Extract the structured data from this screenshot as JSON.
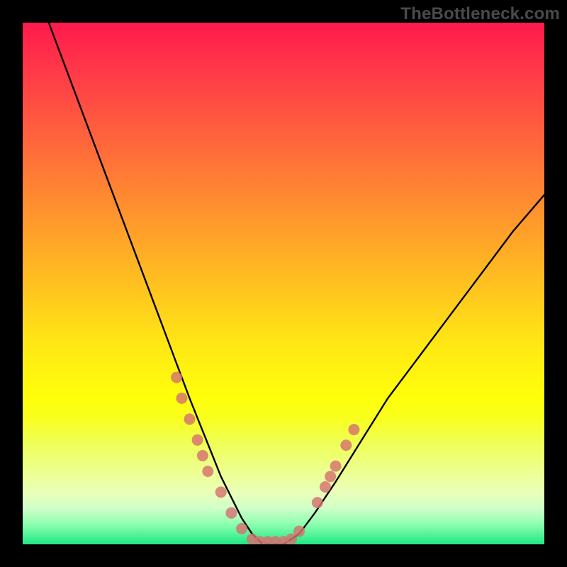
{
  "watermark": "TheBottleneck.com",
  "chart_data": {
    "type": "line",
    "title": "",
    "xlabel": "",
    "ylabel": "",
    "xlim": [
      0,
      100
    ],
    "ylim": [
      0,
      100
    ],
    "grid": false,
    "series": [
      {
        "name": "curve",
        "x": [
          5,
          8,
          11,
          14,
          17,
          20,
          23,
          26,
          29,
          32,
          34,
          36,
          38,
          40,
          42,
          44,
          46,
          48,
          50,
          53,
          56,
          60,
          65,
          70,
          76,
          82,
          88,
          94,
          100
        ],
        "y": [
          100,
          92,
          84,
          76,
          68,
          60,
          52,
          44,
          36,
          28,
          23,
          18,
          13,
          9,
          5,
          2,
          0,
          0,
          0,
          2,
          6,
          12,
          20,
          28,
          36,
          44,
          52,
          60,
          67
        ]
      }
    ],
    "points": {
      "name": "markers",
      "x": [
        29.5,
        30.5,
        32,
        33.5,
        34.5,
        35.5,
        38,
        40,
        42,
        44,
        45.5,
        47,
        48.5,
        50,
        51.5,
        53,
        56.5,
        58,
        59,
        60,
        62,
        63.5
      ],
      "y": [
        32,
        28,
        24,
        20,
        17,
        14,
        10,
        6,
        3,
        1,
        0.5,
        0.5,
        0.5,
        0.5,
        1,
        2.5,
        8,
        11,
        13,
        15,
        19,
        22
      ]
    }
  }
}
